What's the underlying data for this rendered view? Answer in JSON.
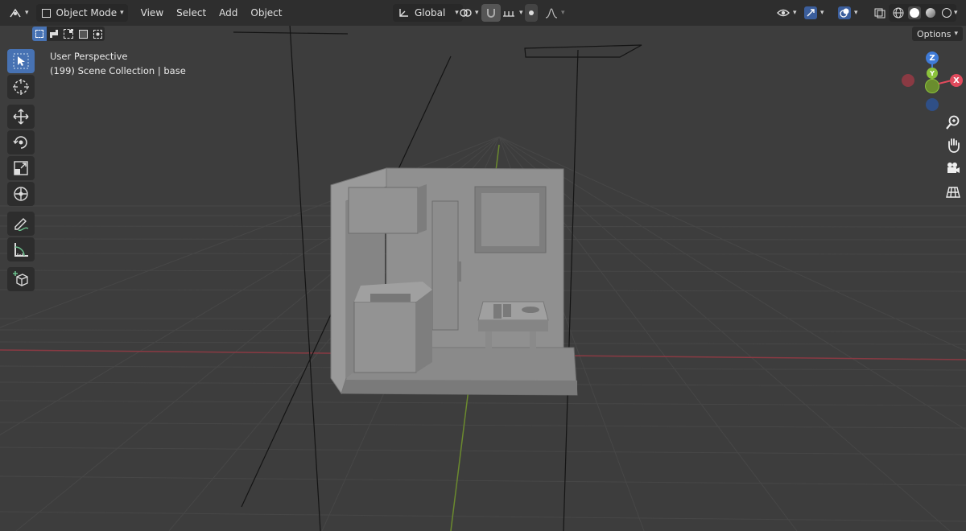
{
  "header": {
    "editor_type_icon": "object-mode-editor-icon",
    "mode_label": "Object Mode",
    "menus": [
      "View",
      "Select",
      "Add",
      "Object"
    ],
    "transform_orientation": "Global",
    "options_label": "Options"
  },
  "viewport_info": {
    "view_name": "User Perspective",
    "scene_line": "(199) Scene Collection | base"
  },
  "toolbar": {
    "tools": [
      "select-box",
      "cursor",
      "move",
      "rotate",
      "scale",
      "transform",
      "annotate",
      "measure",
      "add-cube"
    ],
    "active_tool": "select-box"
  },
  "gizmo": {
    "z_label": "Z",
    "y_label": "Y",
    "x_label": "X",
    "colors": {
      "x": "#e04a5c",
      "y": "#8bc23b",
      "z": "#3f7bd8"
    }
  },
  "colors": {
    "accent": "#4772b3",
    "header_bg": "#2e2e2e",
    "viewport_bg": "#3d3d3d",
    "grid": "#474747",
    "model": "#8c8c8c"
  }
}
